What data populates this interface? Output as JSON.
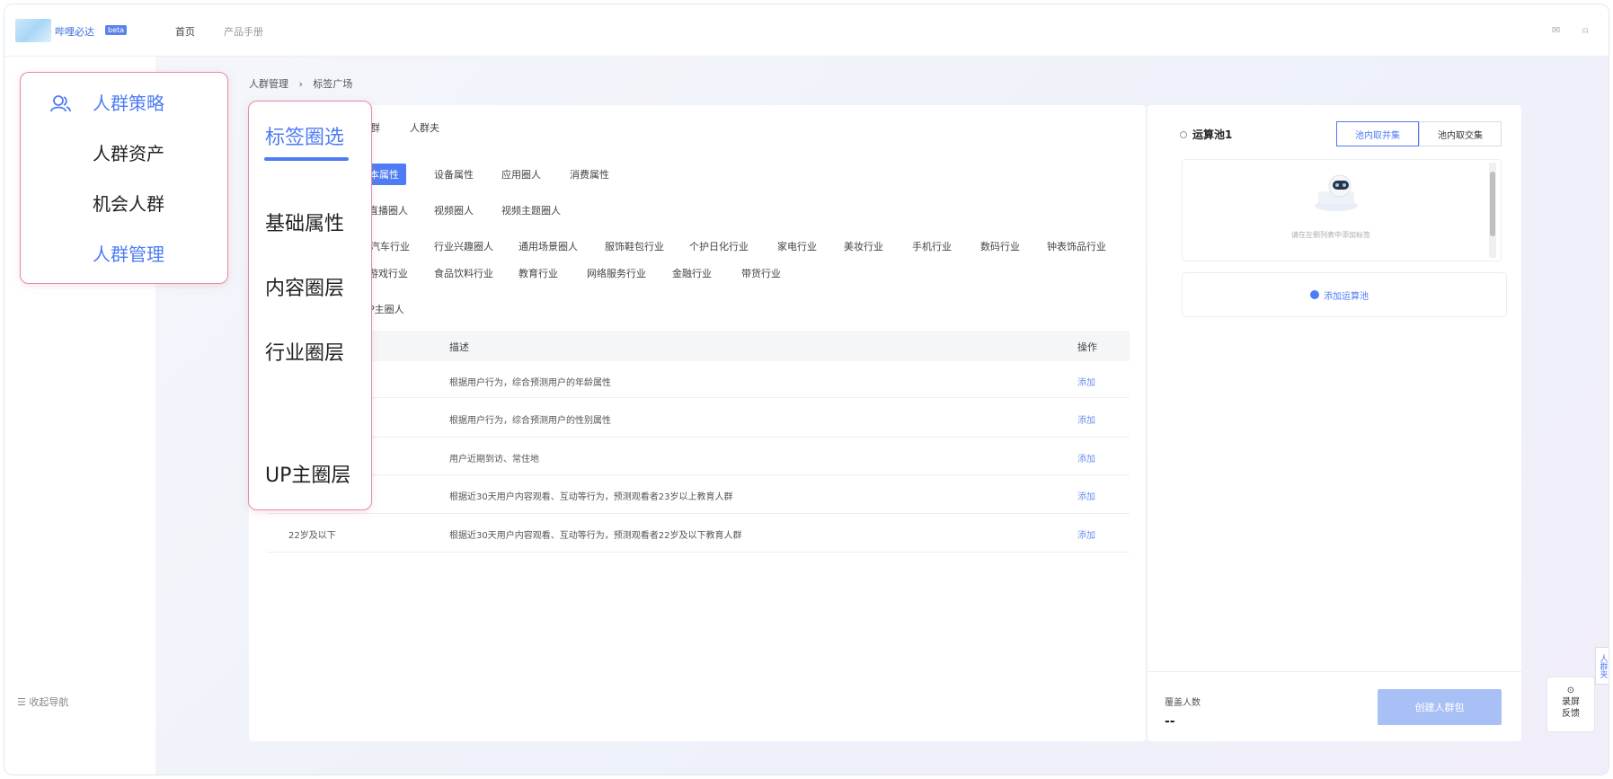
{
  "topbar": {
    "logo_text": "哔哩必达",
    "logo_tag": "beta",
    "nav": [
      {
        "label": "首页"
      },
      {
        "label": "产品手册"
      }
    ],
    "right_icons": [
      "mail-icon",
      "user-icon"
    ]
  },
  "sidebar": {
    "collapse_label": "收起导航"
  },
  "callout_nav": {
    "items": [
      {
        "label": "人群策略"
      },
      {
        "label": "人群资产"
      },
      {
        "label": "机会人群"
      },
      {
        "label": "人群管理"
      }
    ]
  },
  "callout_tabs": {
    "items": [
      {
        "label": "标签圈选"
      },
      {
        "label": "基础属性"
      },
      {
        "label": "内容圈层"
      },
      {
        "label": "行业圈层"
      },
      {
        "label": "UP主圈层"
      }
    ]
  },
  "breadcrumb": {
    "items": [
      "人群管理",
      "›",
      "标签广场"
    ]
  },
  "left_card": {
    "tab_partial": "群",
    "tab_crowd_pack": "人群夫",
    "basic_chips": [
      "本属性",
      "设备属性",
      "应用圈人",
      "消费属性"
    ],
    "content_chips": [
      "直播圈人",
      "视频圈人",
      "视频主题圈人"
    ],
    "industry_row1": [
      "汽车行业",
      "行业兴趣圈人",
      "通用场景圈人",
      "服饰鞋包行业",
      "个护日化行业",
      "家电行业",
      "美妆行业",
      "手机行业",
      "数码行业",
      "钟表饰品行业"
    ],
    "industry_row2": [
      "游戏行业",
      "食品饮料行业",
      "教育行业",
      "网络服务行业",
      "金融行业",
      "带货行业"
    ],
    "up_chip": "P主圈人",
    "table": {
      "col_desc": "描述",
      "col_action": "操作",
      "rows": [
        {
          "name": "",
          "desc": "根据用户行为，综合预测用户的年龄属性",
          "action": "添加"
        },
        {
          "name": "",
          "desc": "根据用户行为，综合预测用户的性别属性",
          "action": "添加"
        },
        {
          "name": "",
          "desc": "用户近期到访、常住地",
          "action": "添加"
        },
        {
          "name": "",
          "desc": "根据近30天用户内容观看、互动等行为，预测观看者23岁以上教育人群",
          "action": "添加"
        },
        {
          "name": "22岁及以下",
          "desc": "根据近30天用户内容观看、互动等行为，预测观看者22岁及以下教育人群",
          "action": "添加"
        }
      ]
    }
  },
  "right_card": {
    "pool_title": "运算池1",
    "seg_union": "池内取并集",
    "seg_intersect": "池内取交集",
    "empty_hint": "请在左侧列表中添加标签",
    "add_pool": "添加运算池",
    "cover_label": "覆盖人数",
    "cover_value": "--",
    "create_button": "创建人群包"
  },
  "floating": {
    "side_tab": "人群夹",
    "feedback_line1": "录屏",
    "feedback_line2": "反馈"
  },
  "colors": {
    "accent": "#4f7cf4",
    "callout_border": "#e48ba3"
  }
}
